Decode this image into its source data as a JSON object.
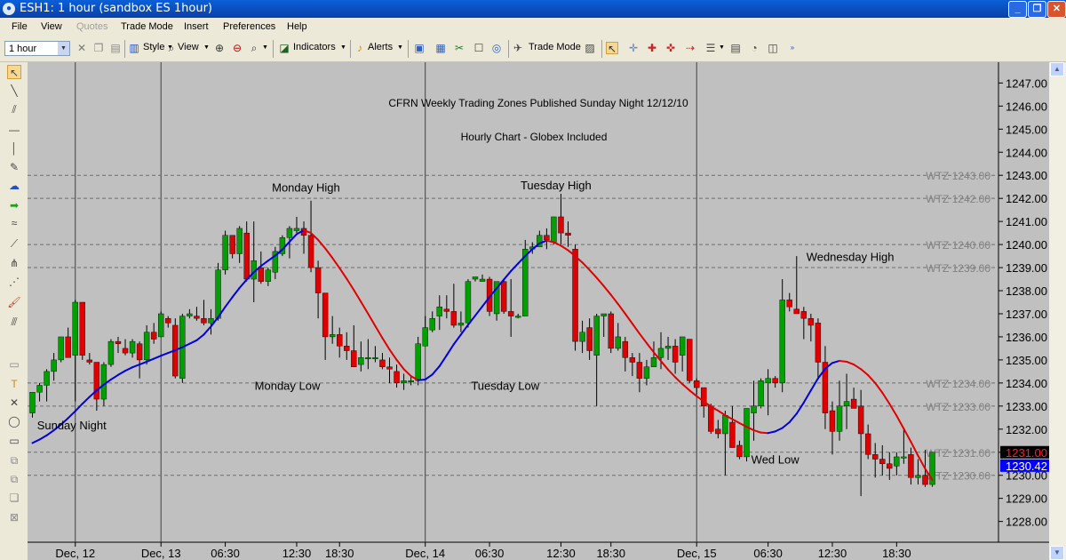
{
  "window": {
    "title": "ESH1: 1 hour (sandbox ES 1hour)",
    "app_icon": "globe-icon",
    "controls": [
      "_",
      "❐",
      "✕"
    ]
  },
  "menu": [
    "File",
    "View",
    "Quotes",
    "Trade Mode",
    "Insert",
    "Preferences",
    "Help"
  ],
  "toolbar": {
    "timeframe": "1 hour",
    "style_label": "Style",
    "view_label": "View",
    "indicators_label": "Indicators",
    "alerts_label": "Alerts",
    "trade_mode_label": "Trade Mode"
  },
  "colors": {
    "chart_bg": "#C0C0C0",
    "bull": "#00A000",
    "bear": "#E00000",
    "ma_rising": "#0000E0",
    "ma_falling": "#E00000",
    "zone_line": "#6E6E6E",
    "price_bear_bg": "#000000",
    "price_bear_fg": "#FF2020",
    "price_now_bg": "#0000FF"
  },
  "chart_data": {
    "type": "candlestick",
    "title": "CFRN Weekly Trading Zones Published Sunday Night 12/12/10",
    "subtitle": "Hourly Chart - Globex Included",
    "ylim": [
      1227.1,
      1247.9
    ],
    "y_ticks": [
      "1228.00",
      "1229.00",
      "1230.00",
      "1231.00",
      "1232.00",
      "1233.00",
      "1234.00",
      "1235.00",
      "1236.00",
      "1237.00",
      "1238.00",
      "1239.00",
      "1240.00",
      "1241.00",
      "1242.00",
      "1243.00",
      "1244.00",
      "1245.00",
      "1246.00",
      "1247.00"
    ],
    "x_ticks": [
      {
        "label": "Dec, 12",
        "i": 6
      },
      {
        "label": "Dec, 13",
        "i": 18
      },
      {
        "label": "06:30",
        "i": 27
      },
      {
        "label": "12:30",
        "i": 37
      },
      {
        "label": "18:30",
        "i": 43
      },
      {
        "label": "Dec, 14",
        "i": 55
      },
      {
        "label": "06:30",
        "i": 64
      },
      {
        "label": "12:30",
        "i": 74
      },
      {
        "label": "18:30",
        "i": 81
      },
      {
        "label": "Dec, 15",
        "i": 93
      },
      {
        "label": "06:30",
        "i": 103
      },
      {
        "label": "12:30",
        "i": 112
      },
      {
        "label": "18:30",
        "i": 121
      }
    ],
    "session_separators": [
      6,
      18,
      55,
      93
    ],
    "zones": [
      {
        "label": "WTZ 1243.00",
        "value": 1243.0
      },
      {
        "label": "WTZ 1242.00",
        "value": 1242.0
      },
      {
        "label": "WTZ 1240.00",
        "value": 1240.0
      },
      {
        "label": "WTZ 1239.00",
        "value": 1239.0
      },
      {
        "label": "WTZ 1234.00",
        "value": 1234.0
      },
      {
        "label": "WTZ 1233.00",
        "value": 1233.0
      },
      {
        "label": "WTZ 1231.00",
        "value": 1231.0
      },
      {
        "label": "WTZ 1230.00",
        "value": 1230.0
      }
    ],
    "price_labels": [
      {
        "text": "1231.00",
        "value": 1231.0,
        "kind": "bear"
      },
      {
        "text": "1230.42",
        "value": 1230.42,
        "kind": "now"
      }
    ],
    "annotations": [
      {
        "text": "Sunday Night",
        "i": 5.5,
        "y": 1232.0
      },
      {
        "text": "Monday High",
        "i": 38.3,
        "y": 1242.3
      },
      {
        "text": "Monday Low",
        "i": 35.7,
        "y": 1233.7
      },
      {
        "text": "Tuesday High",
        "i": 73.3,
        "y": 1242.4
      },
      {
        "text": "Tuesday Low",
        "i": 66.2,
        "y": 1233.7
      },
      {
        "text": "Wednesday High",
        "i": 114.5,
        "y": 1239.3
      },
      {
        "text": "Wed Low",
        "i": 104.0,
        "y": 1230.5
      }
    ],
    "candles": [
      [
        1232.7,
        1233.6,
        1232.5,
        1233.6
      ],
      [
        1233.6,
        1234.0,
        1233.2,
        1233.9
      ],
      [
        1233.9,
        1234.6,
        1233.2,
        1234.5
      ],
      [
        1234.5,
        1235.3,
        1234.1,
        1235.0
      ],
      [
        1235.0,
        1235.9,
        1234.9,
        1236.0
      ],
      [
        1236.0,
        1236.4,
        1235.2,
        1235.1
      ],
      [
        1235.2,
        1237.6,
        1233.2,
        1237.5
      ],
      [
        1237.5,
        1237.5,
        1235.0,
        1235.2
      ],
      [
        1235.0,
        1235.3,
        1234.8,
        1234.9
      ],
      [
        1234.9,
        1234.9,
        1232.8,
        1233.3
      ],
      [
        1233.3,
        1234.9,
        1233.0,
        1234.8
      ],
      [
        1234.8,
        1235.9,
        1234.7,
        1235.8
      ],
      [
        1235.8,
        1236.0,
        1235.3,
        1235.7
      ],
      [
        1235.5,
        1235.9,
        1235.2,
        1235.3
      ],
      [
        1235.3,
        1235.9,
        1235.1,
        1235.8
      ],
      [
        1235.7,
        1235.8,
        1234.2,
        1235.0
      ],
      [
        1235.0,
        1236.5,
        1234.8,
        1236.2
      ],
      [
        1236.2,
        1236.6,
        1235.7,
        1235.9
      ],
      [
        1236.0,
        1237.1,
        1236.0,
        1237.0
      ],
      [
        1236.8,
        1236.9,
        1236.4,
        1236.6
      ],
      [
        1236.5,
        1236.8,
        1234.2,
        1234.3
      ],
      [
        1234.2,
        1237.0,
        1234.0,
        1236.9
      ],
      [
        1236.9,
        1237.2,
        1236.8,
        1237.0
      ],
      [
        1236.9,
        1237.3,
        1236.7,
        1236.8
      ],
      [
        1236.8,
        1237.6,
        1236.5,
        1236.6
      ],
      [
        1236.6,
        1237.2,
        1236.1,
        1236.8
      ],
      [
        1236.8,
        1239.2,
        1236.7,
        1238.9
      ],
      [
        1238.9,
        1240.6,
        1238.7,
        1240.4
      ],
      [
        1240.4,
        1240.4,
        1239.4,
        1239.6
      ],
      [
        1239.6,
        1240.8,
        1239.2,
        1240.7
      ],
      [
        1240.5,
        1241.0,
        1238.4,
        1238.5
      ],
      [
        1238.5,
        1241.0,
        1237.5,
        1239.3
      ],
      [
        1239.0,
        1239.7,
        1238.3,
        1238.4
      ],
      [
        1238.4,
        1239.0,
        1238.2,
        1238.9
      ],
      [
        1238.8,
        1239.9,
        1238.5,
        1239.7
      ],
      [
        1239.6,
        1240.4,
        1239.5,
        1240.3
      ],
      [
        1240.3,
        1240.8,
        1239.4,
        1240.7
      ],
      [
        1240.6,
        1241.2,
        1240.5,
        1240.7
      ],
      [
        1240.7,
        1241.0,
        1239.6,
        1240.4
      ],
      [
        1240.4,
        1241.9,
        1238.8,
        1239.0
      ],
      [
        1239.0,
        1239.3,
        1236.8,
        1237.9
      ],
      [
        1237.9,
        1237.9,
        1235.0,
        1236.0
      ],
      [
        1236.0,
        1236.9,
        1235.7,
        1236.1
      ],
      [
        1236.1,
        1236.4,
        1235.1,
        1235.6
      ],
      [
        1235.6,
        1236.2,
        1235.0,
        1235.4
      ],
      [
        1235.4,
        1236.5,
        1234.7,
        1234.7
      ],
      [
        1234.8,
        1235.8,
        1234.5,
        1235.1
      ],
      [
        1235.1,
        1235.9,
        1234.6,
        1235.1
      ],
      [
        1235.1,
        1235.6,
        1234.9,
        1235.1
      ],
      [
        1235.0,
        1235.3,
        1234.6,
        1234.7
      ],
      [
        1234.7,
        1235.1,
        1234.0,
        1234.6
      ],
      [
        1234.5,
        1234.8,
        1233.8,
        1234.0
      ],
      [
        1234.0,
        1234.4,
        1233.7,
        1234.1
      ],
      [
        1234.1,
        1234.3,
        1233.9,
        1234.1
      ],
      [
        1234.1,
        1236.0,
        1233.9,
        1235.7
      ],
      [
        1235.6,
        1236.9,
        1235.6,
        1236.4
      ],
      [
        1236.3,
        1237.1,
        1236.2,
        1236.8
      ],
      [
        1236.9,
        1237.8,
        1236.3,
        1237.3
      ],
      [
        1237.2,
        1237.8,
        1236.8,
        1237.1
      ],
      [
        1237.1,
        1238.3,
        1236.4,
        1236.5
      ],
      [
        1236.5,
        1237.1,
        1236.2,
        1236.6
      ],
      [
        1236.6,
        1238.5,
        1236.4,
        1238.4
      ],
      [
        1238.5,
        1238.6,
        1238.4,
        1238.6
      ],
      [
        1238.4,
        1238.7,
        1238.4,
        1238.5
      ],
      [
        1238.5,
        1238.6,
        1236.9,
        1237.1
      ],
      [
        1237.0,
        1238.0,
        1236.7,
        1238.4
      ],
      [
        1238.4,
        1238.5,
        1237.0,
        1237.1
      ],
      [
        1237.1,
        1238.5,
        1236.0,
        1236.9
      ],
      [
        1236.9,
        1237.0,
        1236.8,
        1236.9
      ],
      [
        1236.9,
        1240.2,
        1236.9,
        1239.8
      ],
      [
        1239.8,
        1240.1,
        1239.6,
        1239.9
      ],
      [
        1239.9,
        1240.6,
        1239.9,
        1240.4
      ],
      [
        1240.4,
        1240.7,
        1239.8,
        1240.2
      ],
      [
        1240.1,
        1241.2,
        1240.0,
        1241.2
      ],
      [
        1241.2,
        1242.2,
        1240.0,
        1240.5
      ],
      [
        1240.5,
        1241.0,
        1239.9,
        1240.4
      ],
      [
        1239.8,
        1240.0,
        1235.4,
        1235.8
      ],
      [
        1235.8,
        1236.7,
        1235.3,
        1236.2
      ],
      [
        1236.4,
        1236.8,
        1235.0,
        1235.4
      ],
      [
        1235.2,
        1237.0,
        1233.0,
        1236.9
      ],
      [
        1236.9,
        1237.0,
        1236.0,
        1237.0
      ],
      [
        1237.0,
        1237.1,
        1235.3,
        1235.5
      ],
      [
        1235.5,
        1236.6,
        1235.4,
        1236.0
      ],
      [
        1235.8,
        1236.0,
        1234.5,
        1235.1
      ],
      [
        1235.1,
        1235.3,
        1234.3,
        1234.9
      ],
      [
        1234.9,
        1235.3,
        1233.6,
        1234.2
      ],
      [
        1234.2,
        1235.0,
        1233.9,
        1234.7
      ],
      [
        1234.7,
        1235.8,
        1234.7,
        1235.1
      ],
      [
        1235.1,
        1236.2,
        1234.6,
        1235.5
      ],
      [
        1235.5,
        1236.0,
        1235.0,
        1235.6
      ],
      [
        1235.6,
        1235.9,
        1234.4,
        1234.9
      ],
      [
        1235.2,
        1236.0,
        1234.5,
        1236.0
      ],
      [
        1235.9,
        1235.9,
        1234.0,
        1234.1
      ],
      [
        1234.1,
        1234.2,
        1233.5,
        1233.8
      ],
      [
        1233.8,
        1233.8,
        1232.5,
        1233.0
      ],
      [
        1233.0,
        1233.1,
        1231.8,
        1231.9
      ],
      [
        1232.0,
        1232.4,
        1231.6,
        1231.8
      ],
      [
        1231.8,
        1232.8,
        1230.0,
        1232.6
      ],
      [
        1232.3,
        1233.0,
        1231.3,
        1231.2
      ],
      [
        1231.3,
        1231.5,
        1230.7,
        1230.8
      ],
      [
        1230.8,
        1232.9,
        1230.6,
        1232.9
      ],
      [
        1232.7,
        1234.1,
        1231.5,
        1233.0
      ],
      [
        1233.0,
        1234.2,
        1232.9,
        1234.1
      ],
      [
        1234.0,
        1234.6,
        1232.6,
        1234.2
      ],
      [
        1234.2,
        1234.3,
        1233.8,
        1234.0
      ],
      [
        1234.0,
        1238.5,
        1233.6,
        1237.6
      ],
      [
        1237.6,
        1237.9,
        1237.1,
        1237.3
      ],
      [
        1237.2,
        1239.5,
        1237.0,
        1237.0
      ],
      [
        1237.1,
        1237.3,
        1235.9,
        1236.8
      ],
      [
        1236.8,
        1237.0,
        1235.8,
        1236.5
      ],
      [
        1236.6,
        1236.8,
        1234.2,
        1234.9
      ],
      [
        1234.9,
        1235.6,
        1232.0,
        1232.7
      ],
      [
        1232.8,
        1233.2,
        1230.9,
        1231.9
      ],
      [
        1231.9,
        1234.1,
        1231.5,
        1233.0
      ],
      [
        1233.0,
        1234.4,
        1232.0,
        1233.2
      ],
      [
        1233.3,
        1233.8,
        1232.9,
        1232.9
      ],
      [
        1233.0,
        1233.7,
        1229.1,
        1231.8
      ],
      [
        1231.8,
        1232.2,
        1230.7,
        1230.9
      ],
      [
        1230.9,
        1231.4,
        1229.9,
        1230.7
      ],
      [
        1230.7,
        1231.3,
        1230.0,
        1230.5
      ],
      [
        1230.5,
        1231.0,
        1229.8,
        1230.3
      ],
      [
        1230.4,
        1231.0,
        1230.0,
        1230.8
      ],
      [
        1230.8,
        1232.0,
        1230.5,
        1230.8
      ],
      [
        1230.9,
        1231.2,
        1229.6,
        1229.9
      ],
      [
        1229.9,
        1230.7,
        1229.6,
        1230.0
      ],
      [
        1230.0,
        1231.1,
        1229.5,
        1229.6
      ],
      [
        1229.6,
        1231.0,
        1229.5,
        1231.0
      ]
    ],
    "ma": [
      1231.4,
      1231.55,
      1231.73,
      1231.95,
      1232.2,
      1232.48,
      1232.78,
      1233.1,
      1233.4,
      1233.68,
      1233.93,
      1234.15,
      1234.35,
      1234.53,
      1234.68,
      1234.8,
      1234.92,
      1235.05,
      1235.18,
      1235.3,
      1235.42,
      1235.55,
      1235.7,
      1235.85,
      1236.1,
      1236.45,
      1236.85,
      1237.3,
      1237.72,
      1238.12,
      1238.48,
      1238.8,
      1239.07,
      1239.3,
      1239.52,
      1239.78,
      1240.12,
      1240.45,
      1240.62,
      1240.5,
      1240.2,
      1239.83,
      1239.42,
      1238.98,
      1238.52,
      1238.03,
      1237.52,
      1237.0,
      1236.47,
      1235.95,
      1235.45,
      1235.0,
      1234.6,
      1234.3,
      1234.12,
      1234.15,
      1234.37,
      1234.73,
      1235.2,
      1235.68,
      1236.1,
      1236.52,
      1236.92,
      1237.32,
      1237.72,
      1238.1,
      1238.48,
      1238.85,
      1239.18,
      1239.5,
      1239.8,
      1240.05,
      1240.17,
      1240.1,
      1239.95,
      1239.75,
      1239.5,
      1239.22,
      1238.9,
      1238.56,
      1238.2,
      1237.82,
      1237.42,
      1237.0,
      1236.57,
      1236.14,
      1235.73,
      1235.33,
      1234.95,
      1234.58,
      1234.25,
      1233.95,
      1233.68,
      1233.43,
      1233.2,
      1232.98,
      1232.8,
      1232.6,
      1232.43,
      1232.26,
      1232.1,
      1231.95,
      1231.85,
      1231.83,
      1231.9,
      1232.05,
      1232.3,
      1232.67,
      1233.15,
      1233.68,
      1234.2,
      1234.62,
      1234.87,
      1234.96,
      1234.92,
      1234.8,
      1234.6,
      1234.34,
      1234.0,
      1233.58,
      1233.1,
      1232.58,
      1232.02,
      1231.45,
      1230.85,
      1230.28,
      1229.8
    ]
  }
}
